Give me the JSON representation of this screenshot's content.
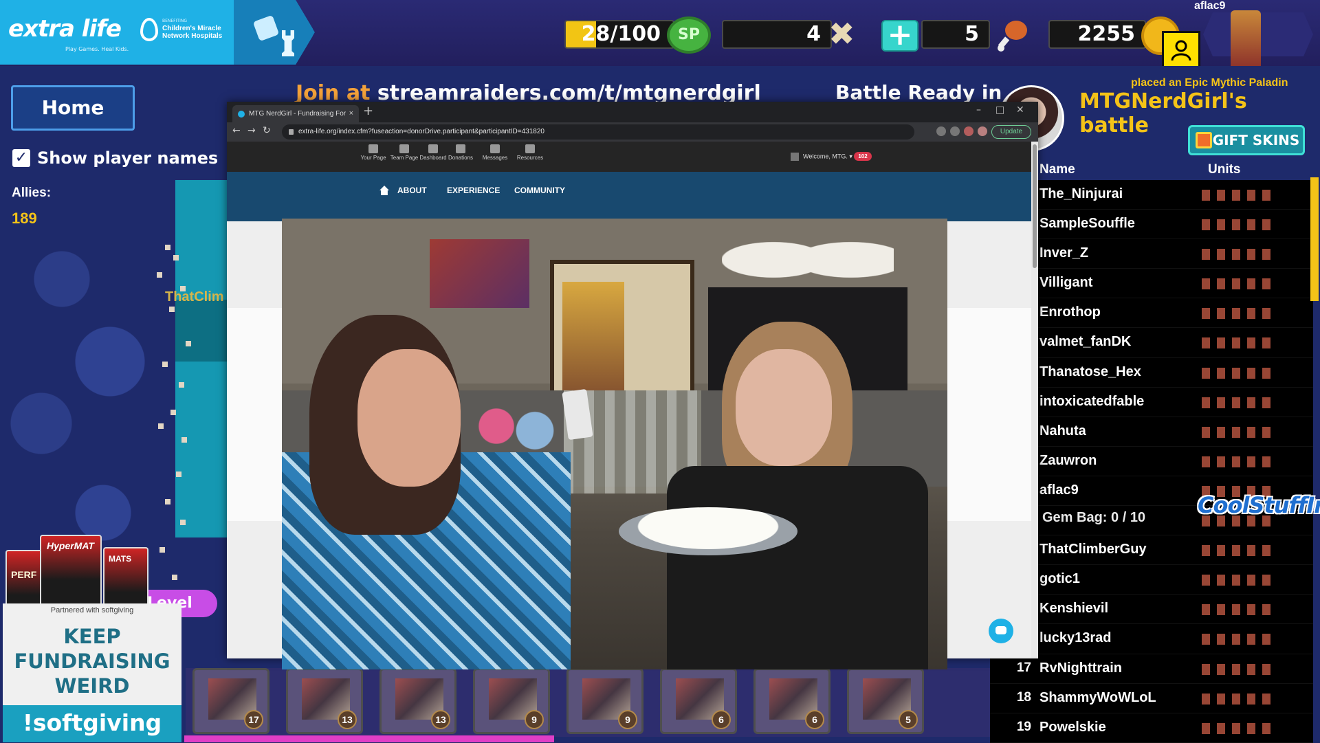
{
  "hud": {
    "username": "aflac9",
    "sp": {
      "text": "28/100",
      "current": 28,
      "max": 100,
      "fill_fraction": 0.28,
      "icon_label": "SP"
    },
    "bones": "4",
    "meat": "5",
    "gold": "2255",
    "plus_label": "+"
  },
  "brand": {
    "name": "extra life",
    "tagline": "Play Games. Heal Kids.",
    "benefiting": "BENEFITING",
    "cmn": "Children's Miracle Network Hospitals"
  },
  "game": {
    "home_label": "Home",
    "show_names_label": "Show player names",
    "allies_label": "Allies:",
    "allies_count": "189",
    "join_prefix": "Join at",
    "join_url": "streamraiders.com/t/mtgnerdgirl",
    "battle_ready": "Battle Ready in",
    "ghost_name": "ThatClim",
    "level_label": "Level"
  },
  "raid": {
    "placed_text": "placed an Epic Mythic Paladin",
    "battle_title": "MTGNerdGirl's battle",
    "gift_label": "GIFT SKINS",
    "col_name": "Name",
    "col_units": "Units",
    "players": [
      {
        "rank": "",
        "name": "The_Ninjurai"
      },
      {
        "rank": "",
        "name": "SampleSouffle"
      },
      {
        "rank": "",
        "name": "Inver_Z"
      },
      {
        "rank": "",
        "name": "Villigant"
      },
      {
        "rank": "",
        "name": "Enrothop"
      },
      {
        "rank": "",
        "name": "valmet_fanDK"
      },
      {
        "rank": "",
        "name": "Thanatose_Hex"
      },
      {
        "rank": "",
        "name": "intoxicatedfable"
      },
      {
        "rank": "",
        "name": "Nahuta"
      },
      {
        "rank": "",
        "name": "Zauwron"
      },
      {
        "rank": "",
        "name": "aflac9"
      },
      {
        "rank": "",
        "name": ""
      },
      {
        "rank": "",
        "name": "ThatClimberGuy"
      },
      {
        "rank": "",
        "name": "gotic1"
      },
      {
        "rank": "",
        "name": "Kenshievil"
      },
      {
        "rank": "",
        "name": "lucky13rad"
      },
      {
        "rank": "17",
        "name": "RvNighttrain"
      },
      {
        "rank": "18",
        "name": "ShammyWoWLoL"
      },
      {
        "rank": "19",
        "name": "Powelskie"
      }
    ],
    "gem_overlay": "Gem Bag: 0 / 10",
    "sponsor_logo": "CoolStuffInc"
  },
  "unit_bar": {
    "levels": [
      "17",
      "13",
      "13",
      "9",
      "9",
      "6",
      "6",
      "5"
    ],
    "progress_fraction": 0.46
  },
  "sponsor": {
    "box_labels": [
      "PERF",
      "HyperMAT",
      "MATS"
    ],
    "partner_line": "Partnered with softgiving",
    "keep_text": "KEEP FUNDRAISING WEIRD",
    "softgiving": "!softgiving"
  },
  "browser": {
    "tab_title": "MTG NerdGirl - Fundraising For",
    "tab_close": "×",
    "new_tab": "+",
    "url": "extra-life.org/index.cfm?fuseaction=donorDrive.participant&participantID=431820",
    "update_label": "Update",
    "nav_items": [
      "Your Page",
      "Team Page",
      "Dashboard",
      "Donations",
      "Messages",
      "Resources"
    ],
    "welcome": "Welcome, MTG.",
    "notif_count": "102",
    "menu": [
      "ABOUT",
      "EXPERIENCE",
      "COMMUNITY"
    ]
  },
  "colors": {
    "brand_blue": "#1fb1e6",
    "gold": "#f4c318",
    "teal": "#37d5cc",
    "board": "#1e2a6b"
  }
}
